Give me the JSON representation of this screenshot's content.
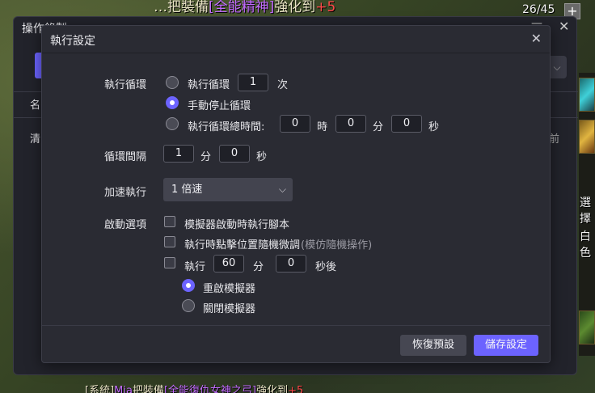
{
  "background": {
    "top_text_a": "…",
    "top_text_b": "把裝備",
    "top_text_item": "[全能精神]",
    "top_text_c": "強化到",
    "top_text_plus": "+5",
    "counter": "26/45",
    "plus_button": "+",
    "side_text_1": "選擇",
    "side_text_2": "白色",
    "bottom_text_a": "[系統]",
    "bottom_text_name": "Mia",
    "bottom_text_b": "把裝備",
    "bottom_text_item": "[全能復仇女神之弓]",
    "bottom_text_c": "強化到",
    "bottom_text_plus": "+5"
  },
  "back_panel": {
    "title": "操作錄製",
    "min": "—",
    "close": "✕",
    "row_name": "名",
    "row_clear": "清",
    "row_right": "前"
  },
  "dialog": {
    "title": "執行設定",
    "close_icon": "✕",
    "loop": {
      "label": "執行循環",
      "option_count_label": "執行循環",
      "count_value": "1",
      "count_unit": "次",
      "option_manual_label": "手動停止循環",
      "option_total_label": "執行循環總時間:",
      "total_hours": "0",
      "hours_unit": "時",
      "total_minutes": "0",
      "minutes_unit": "分",
      "total_seconds": "0",
      "seconds_unit": "秒",
      "selected": "manual"
    },
    "interval": {
      "label": "循環間隔",
      "minutes": "1",
      "minutes_unit": "分",
      "seconds": "0",
      "seconds_unit": "秒"
    },
    "speed": {
      "label": "加速執行",
      "selected": "1 倍速",
      "chevron": "⌵"
    },
    "startup": {
      "label": "啟動選項",
      "opt1": "模擬器啟動時執行腳本",
      "opt2": "執行時點擊位置隨機微調",
      "opt2_hint": "(模仿隨機操作)",
      "opt3_prefix": "執行",
      "opt3_minutes": "60",
      "opt3_minutes_unit": "分",
      "opt3_seconds": "0",
      "opt3_seconds_unit": "秒後",
      "sub_restart": "重啟模擬器",
      "sub_close": "關閉模擬器",
      "sub_selected": "restart"
    },
    "buttons": {
      "reset": "恢復預設",
      "save": "儲存設定"
    }
  },
  "colors": {
    "accent": "#6c63ff",
    "dialog_bg": "#2a2b33",
    "input_bg": "#1f2027"
  }
}
